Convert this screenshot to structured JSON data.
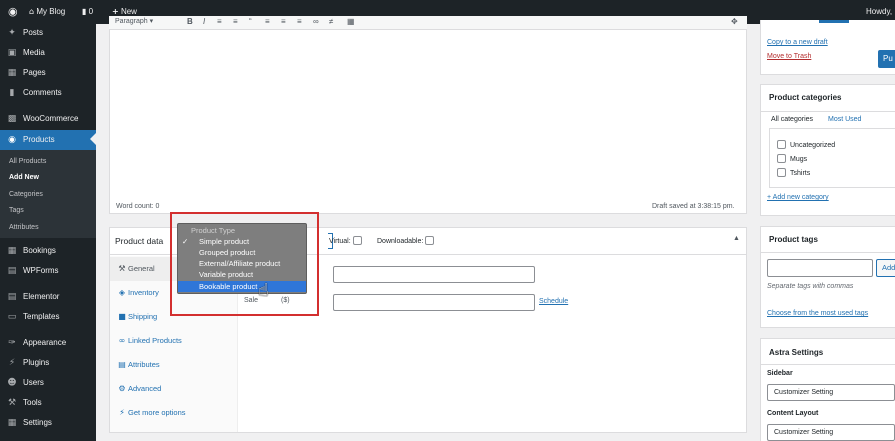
{
  "adminbar": {
    "site_name": "My Blog",
    "comments_count": "0",
    "new_label": "New",
    "howdy": "Howdy,"
  },
  "sidemenu": {
    "items": [
      {
        "label": "Posts",
        "icon": "pin-icon"
      },
      {
        "label": "Media",
        "icon": "media-icon"
      },
      {
        "label": "Pages",
        "icon": "pages-icon"
      },
      {
        "label": "Comments",
        "icon": "comments-icon"
      },
      {
        "label": "WooCommerce",
        "icon": "woocommerce-icon"
      },
      {
        "label": "Products",
        "icon": "products-icon"
      },
      {
        "label": "Bookings",
        "icon": "calendar-icon"
      },
      {
        "label": "WPForms",
        "icon": "wpforms-icon"
      },
      {
        "label": "Elementor",
        "icon": "elementor-icon"
      },
      {
        "label": "Templates",
        "icon": "folder-icon"
      },
      {
        "label": "Appearance",
        "icon": "brush-icon"
      },
      {
        "label": "Plugins",
        "icon": "plugin-icon"
      },
      {
        "label": "Users",
        "icon": "user-icon"
      },
      {
        "label": "Tools",
        "icon": "wrench-icon"
      },
      {
        "label": "Settings",
        "icon": "settings-icon"
      }
    ],
    "submenu": [
      "All Products",
      "Add New",
      "Categories",
      "Tags",
      "Attributes"
    ]
  },
  "editor": {
    "format_select": "Paragraph",
    "word_count": "Word count: 0",
    "draft_saved": "Draft saved at 3:38:15 pm."
  },
  "product_data": {
    "title": "Product data",
    "virtual_label": "Virtual:",
    "downloadable_label": "Downloadable:",
    "tabs": [
      {
        "label": "General",
        "icon": "wrench-icon"
      },
      {
        "label": "Inventory",
        "icon": "diamond-icon"
      },
      {
        "label": "Shipping",
        "icon": "truck-icon"
      },
      {
        "label": "Linked Products",
        "icon": "link-icon"
      },
      {
        "label": "Attributes",
        "icon": "table-icon"
      },
      {
        "label": "Advanced",
        "icon": "gear-icon"
      },
      {
        "label": "Get more options",
        "icon": "plugin-icon"
      }
    ],
    "sale_label_fragment": "Sale",
    "sale_label_suffix": "($)",
    "schedule_link": "Schedule"
  },
  "product_type_dropdown": {
    "header": "Product Type",
    "options": [
      "Simple product",
      "Grouped product",
      "External/Affiliate product",
      "Variable product",
      "Bookable product"
    ],
    "checked_index": 0,
    "highlighted_index": 4
  },
  "publish_box": {
    "copy_draft": "Copy to a new draft",
    "move_trash": "Move to Trash",
    "publish_button": "Pu"
  },
  "categories_box": {
    "title": "Product categories",
    "tabs": [
      "All categories",
      "Most Used"
    ],
    "items": [
      "Uncategorized",
      "Mugs",
      "Tshirts"
    ],
    "add_link": "+ Add new category"
  },
  "tags_box": {
    "title": "Product tags",
    "add_button": "Add",
    "hint": "Separate tags with commas",
    "choose_link": "Choose from the most used tags"
  },
  "astra_box": {
    "title": "Astra Settings",
    "sidebar_label": "Sidebar",
    "sidebar_value": "Customizer Setting",
    "content_layout_label": "Content Layout",
    "content_layout_value": "Customizer Setting"
  },
  "colors": {
    "admin_dark": "#1d2327",
    "accent_blue": "#2271b1",
    "dropdown_highlight": "#2f76d8",
    "annotation_red": "#d32f2f"
  }
}
